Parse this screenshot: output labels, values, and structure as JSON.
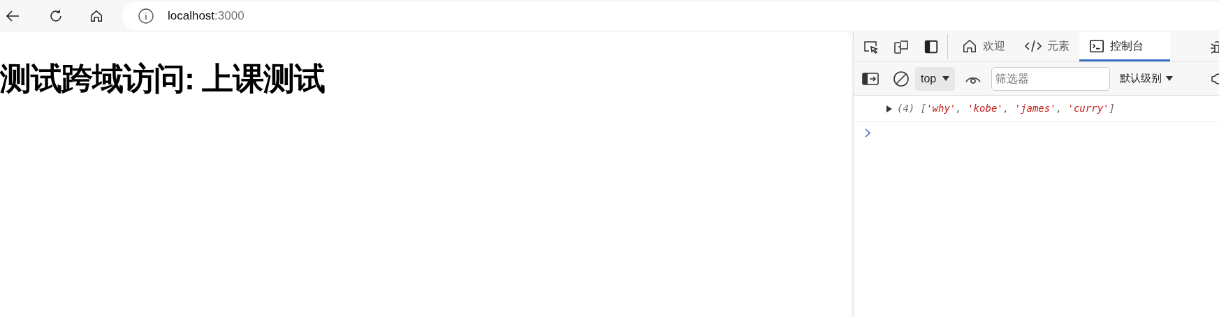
{
  "address_bar": {
    "host": "localhost",
    "port": ":3000"
  },
  "page": {
    "heading": "测试跨域访问: 上课测试"
  },
  "devtools": {
    "tabs": [
      {
        "label": "欢迎",
        "kind": "home",
        "selected": false
      },
      {
        "label": "元素",
        "kind": "code",
        "selected": false
      },
      {
        "label": "控制台",
        "kind": "console",
        "selected": true
      }
    ],
    "context": "top",
    "filter": {
      "placeholder": "筛选器"
    },
    "level": "默认级别",
    "console": [
      {
        "kind": "array",
        "expanded": false,
        "count": "(4)",
        "open": "[",
        "separator": ", ",
        "close": "]",
        "items": [
          "'why'",
          "'kobe'",
          "'james'",
          "'curry'"
        ]
      }
    ]
  }
}
